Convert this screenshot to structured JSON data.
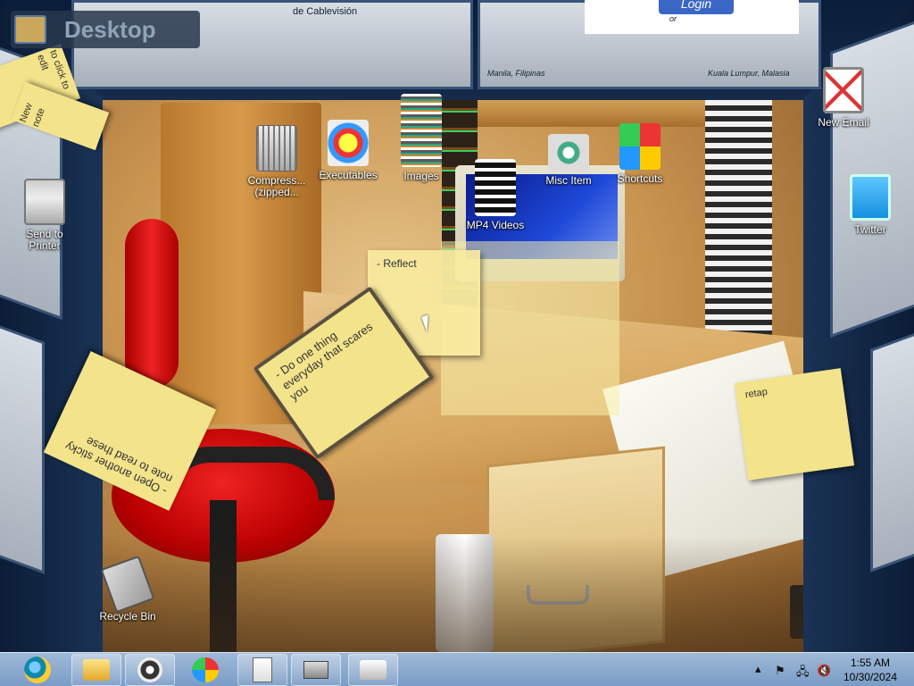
{
  "desktop_label": "Desktop",
  "panels": {
    "top_left_text": "de Cablevisión",
    "top_right": {
      "login": "Login",
      "login_sub": "or",
      "city_left": "Manila, Filipinas",
      "city_right": "Kuala Lumpur, Malasia"
    },
    "left_note_1": "to click to edit",
    "left_note_2": "New note"
  },
  "desktop_icons": [
    {
      "label": "Compress... (zipped...",
      "icon": "zip-folder-icon"
    },
    {
      "label": "Executables",
      "icon": "executables-icon"
    },
    {
      "label": "Images",
      "icon": "images-icon"
    },
    {
      "label": "MP4 Videos",
      "icon": "video-icon"
    },
    {
      "label": "Misc Item",
      "icon": "misc-icon"
    },
    {
      "label": "Shortcuts",
      "icon": "shortcuts-icon"
    },
    {
      "label": "Send to Printer",
      "icon": "printer-icon"
    },
    {
      "label": "New Email",
      "icon": "email-icon"
    },
    {
      "label": "Twitter",
      "icon": "twitter-icon"
    },
    {
      "label": "Recycle Bin",
      "icon": "recycle-bin-icon"
    }
  ],
  "sticky_notes": {
    "reflect": "- Reflect",
    "do_one_thing": "- Do one thing everyday that scares you",
    "open_another": "- Open another sticky note to read these",
    "retap": "retap"
  },
  "taskbar": {
    "apps": [
      {
        "name": "internet-explorer-icon"
      },
      {
        "name": "file-explorer-icon"
      },
      {
        "name": "media-player-icon"
      },
      {
        "name": "paint-icon"
      },
      {
        "name": "document-icon"
      },
      {
        "name": "device-icon"
      },
      {
        "name": "network-app-icon"
      }
    ],
    "time": "1:55 AM",
    "date": "10/30/2024",
    "tray": {
      "chevron": "▴",
      "flag": "⚑",
      "network": "🖧",
      "volume": "🔇"
    }
  },
  "colors": {
    "taskbar": "#8fadd2",
    "sticky_note": "#f3e38a",
    "frame": "#12284a"
  }
}
